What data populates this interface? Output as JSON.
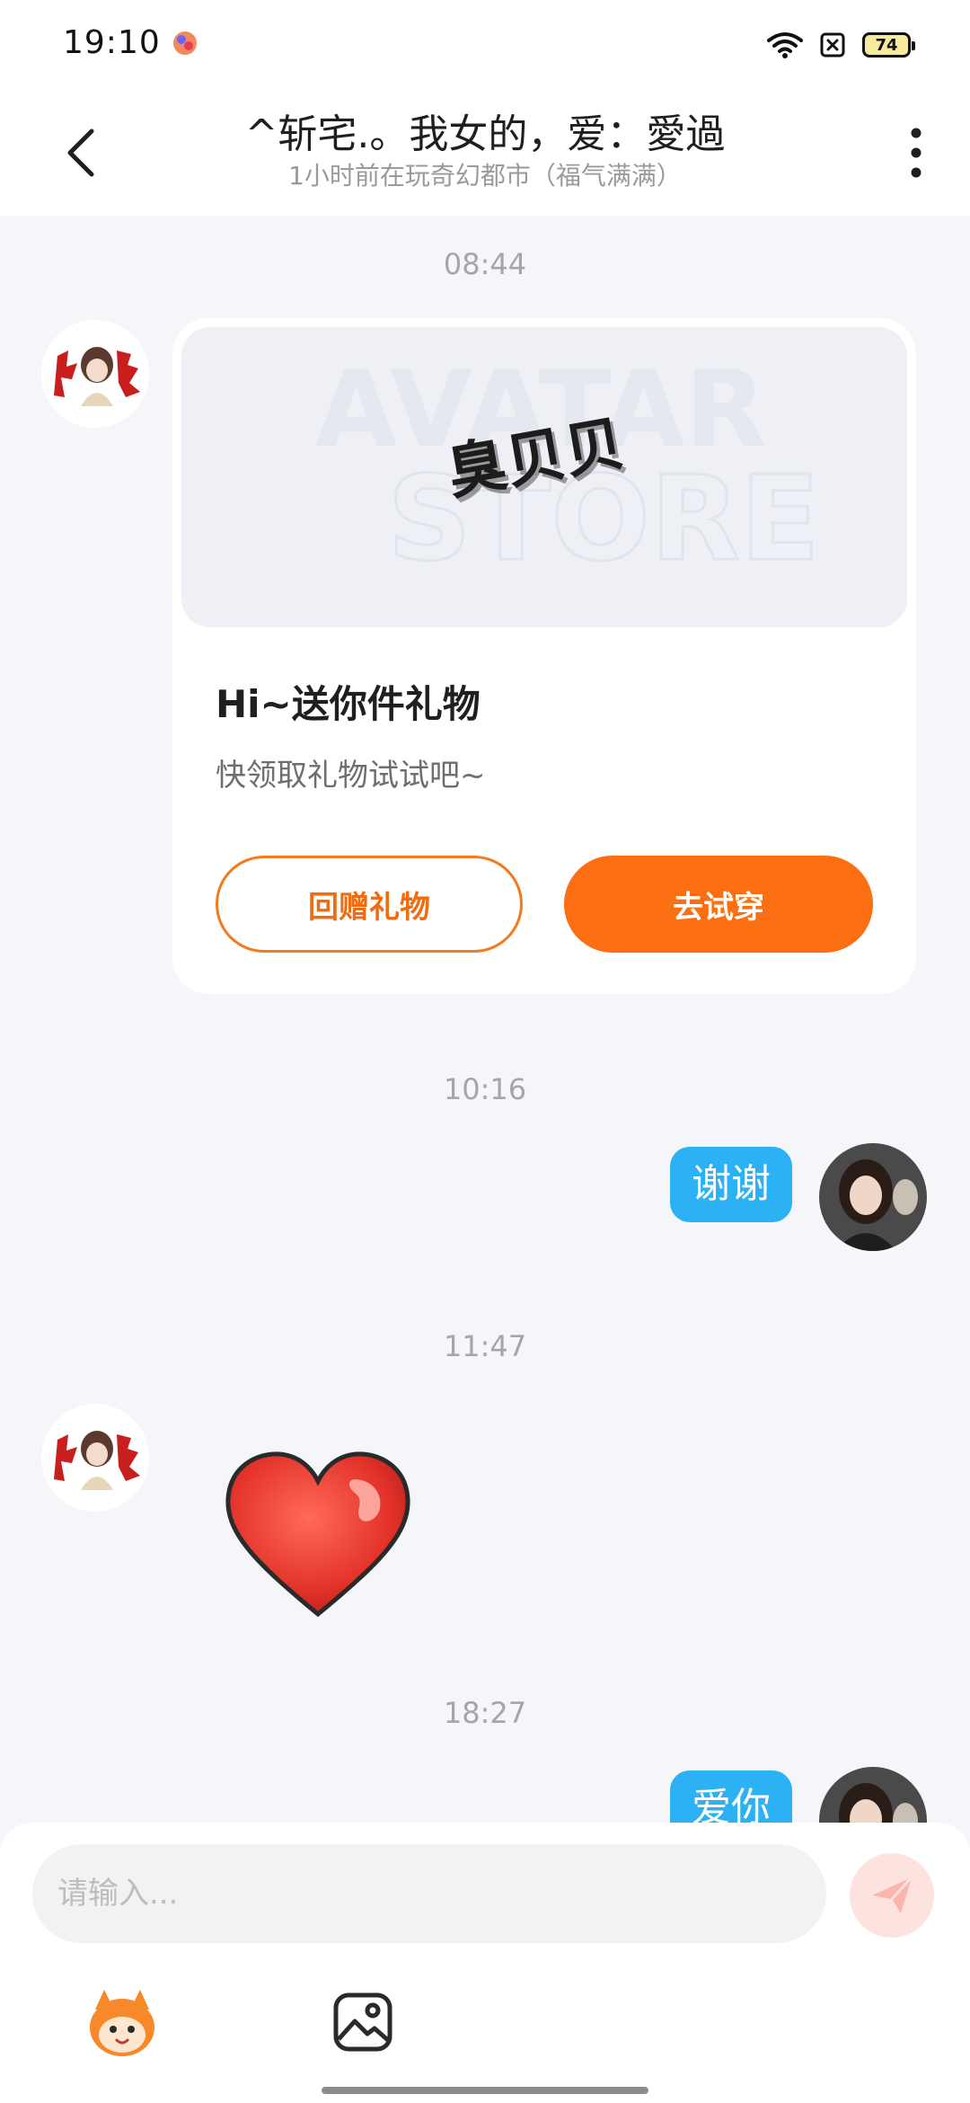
{
  "status_bar": {
    "time": "19:10",
    "battery": "74"
  },
  "header": {
    "title": "^斩宅.。我女的，爱：愛過",
    "subtitle": "1小时前在玩奇幻都市（福气满满）"
  },
  "messages": [
    {
      "timestamp": "08:44",
      "type": "gift_card",
      "gift_card": {
        "title": "Hi~送你件礼物",
        "description": "快领取礼物试试吧~",
        "return_gift_label": "回赠礼物",
        "try_on_label": "去试穿",
        "banner_watermark_top": "AVATAR",
        "banner_watermark_bottom": "STORE",
        "banner_item_text": "臭贝贝"
      }
    },
    {
      "timestamp": "10:16",
      "type": "text",
      "text": "谢谢"
    },
    {
      "timestamp": "11:47",
      "type": "sticker",
      "sticker": "heart-sticker"
    },
    {
      "timestamp": "18:27",
      "type": "text",
      "text": "爱你"
    }
  ],
  "input": {
    "placeholder": "请输入..."
  },
  "colors": {
    "accent_orange": "#fb6f12",
    "bubble_blue": "#2db1f5",
    "chat_background": "#f4f6f9"
  }
}
